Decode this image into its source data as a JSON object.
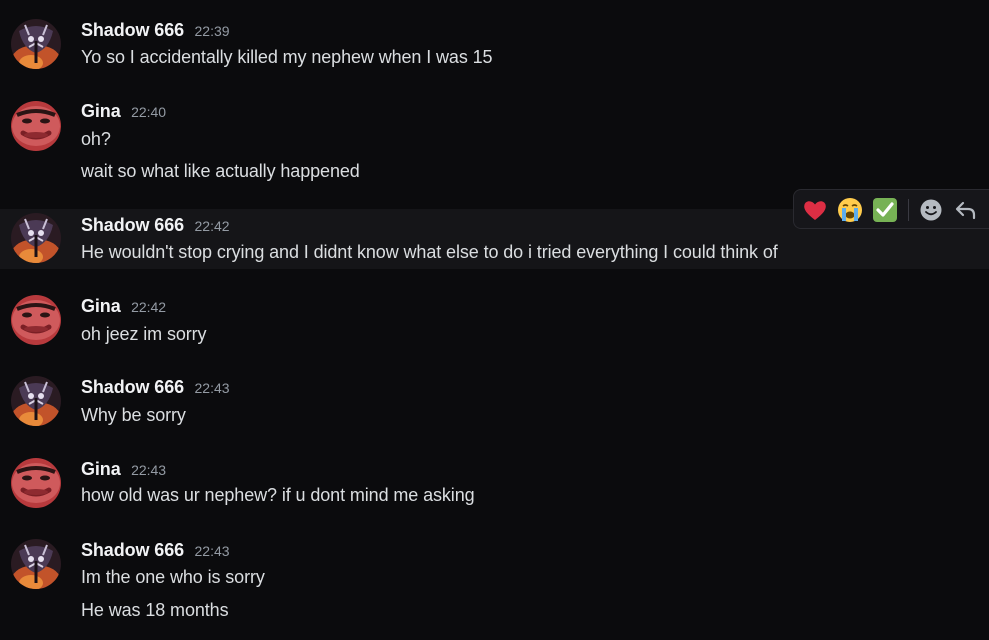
{
  "messages": [
    {
      "author": "Shadow 666",
      "time": "22:39",
      "lines": [
        "Yo so I accidentally killed my nephew when I was 15"
      ]
    },
    {
      "author": "Gina",
      "time": "22:40",
      "lines": [
        "oh?",
        "wait so what like actually happened"
      ]
    },
    {
      "author": "Shadow 666",
      "time": "22:42",
      "lines": [
        "He wouldn't stop crying and I didnt know what else to do i tried everything I could think of"
      ]
    },
    {
      "author": "Gina",
      "time": "22:42",
      "lines": [
        "oh jeez im sorry"
      ]
    },
    {
      "author": "Shadow 666",
      "time": "22:43",
      "lines": [
        "Why be sorry"
      ]
    },
    {
      "author": "Gina",
      "time": "22:43",
      "lines": [
        "how old was ur nephew? if u dont mind me asking"
      ]
    },
    {
      "author": "Shadow 666",
      "time": "22:43",
      "lines": [
        "Im the one who is sorry",
        "He was 18 months"
      ]
    }
  ],
  "toolbar": {
    "reactions": [
      "heart-emoji",
      "crying-emoji",
      "check-mark-emoji"
    ],
    "actions": [
      "add-reaction-icon",
      "reply-icon"
    ]
  },
  "colors": {
    "background": "#0b0b0d",
    "hover_row": "#151518",
    "author": "#f2f3f5",
    "timestamp": "#949ba4",
    "text": "#dbdee1"
  }
}
